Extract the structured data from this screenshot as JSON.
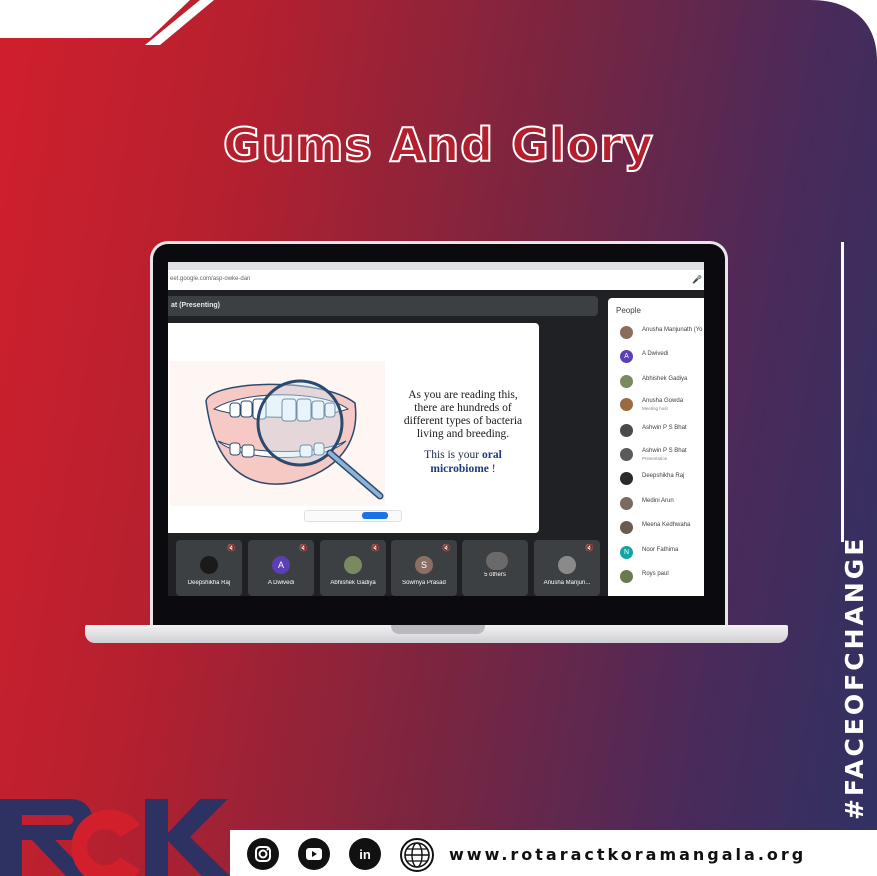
{
  "title": "Gums And Glory",
  "hashtag": "#FACEOFCHANGE",
  "browser": {
    "url": "eet.google.com/asp-owke-dan",
    "presenting_label": "at (Presenting)"
  },
  "slide": {
    "text_lines": [
      "As you are reading this,",
      "there are hundreds of",
      "different types of bacteria",
      "living and breeding."
    ],
    "line2_prefix": "This is your",
    "highlight": "oral microbiome",
    "line2_suffix": " !"
  },
  "people_panel": {
    "title": "People",
    "members": [
      {
        "name": "Anusha Manjunath (Yo",
        "sub": "",
        "avatar": "photo",
        "color": "#8a6d5a"
      },
      {
        "name": "A Dwivedi",
        "sub": "",
        "avatar": "A",
        "color": "#5b3fb5"
      },
      {
        "name": "Abhishek Gadiya",
        "sub": "",
        "avatar": "photo",
        "color": "#7a8a60"
      },
      {
        "name": "Anusha Gowda",
        "sub": "Meeting host",
        "avatar": "photo",
        "color": "#9a6a40"
      },
      {
        "name": "Ashwin P S Bhat",
        "sub": "",
        "avatar": "photo",
        "color": "#4a4a4a"
      },
      {
        "name": "Ashwin P S Bhat",
        "sub": "Presentation",
        "avatar": "photo",
        "color": "#5a5a5a"
      },
      {
        "name": "Deepshikha Raj",
        "sub": "",
        "avatar": "photo",
        "color": "#2a2a2a"
      },
      {
        "name": "Medini Arun",
        "sub": "",
        "avatar": "photo",
        "color": "#7a6a60"
      },
      {
        "name": "Meena Kedhwaha",
        "sub": "",
        "avatar": "photo",
        "color": "#6a5a50"
      },
      {
        "name": "Noor Fathima",
        "sub": "",
        "avatar": "N",
        "color": "#12a4a4"
      },
      {
        "name": "Roys paul",
        "sub": "",
        "avatar": "photo",
        "color": "#6a7a50"
      }
    ]
  },
  "tiles": [
    {
      "name": "Deepshikha Raj",
      "avatar": "photo",
      "color": "#1a1a1a"
    },
    {
      "name": "A Dwivedi",
      "avatar": "A",
      "color": "#5b3fb5"
    },
    {
      "name": "Abhishek Gadiya",
      "avatar": "photo",
      "color": "#7a8a60"
    },
    {
      "name": "Sowmya Prasad",
      "avatar": "S",
      "color": "#8d6e63"
    },
    {
      "name": "5 others",
      "avatar": "group",
      "color": "#6a6a6a"
    },
    {
      "name": "Anusha Manjun...",
      "avatar": "photo",
      "color": "#8a8a8a"
    }
  ],
  "footer": {
    "website": "www.rotaractkoramangala.org",
    "icons": [
      "instagram-icon",
      "youtube-icon",
      "linkedin-icon",
      "globe-icon"
    ]
  },
  "logo_text": "RCK",
  "colors": {
    "accent_red": "#d11f2c",
    "accent_navy": "#2e3263"
  }
}
